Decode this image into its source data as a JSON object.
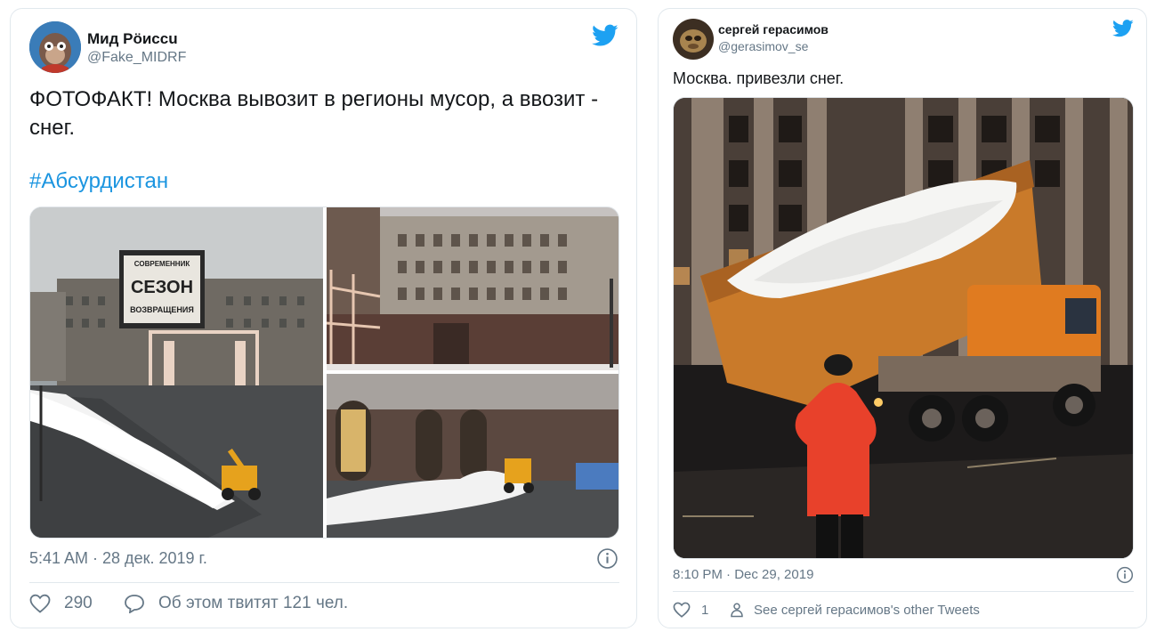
{
  "tweets": [
    {
      "author_name": "Мид Рöиссu",
      "handle": "@Fake_MIDRF",
      "text": "ФОТОФАКТ! Москва вывозит в регионы мусор, а ввозит - снег.",
      "hashtag": "#Абсурдистан",
      "billboard": {
        "line1": "СОВРЕМЕННИК",
        "line2": "СЕЗОН",
        "line3": "ВОЗВРАЩЕНИЯ"
      },
      "timestamp": "5:41 AM · 28 дек. 2019 г.",
      "likes": "290",
      "conversation": "Об этом твитят 121 чел.",
      "icons": [
        "twitter-bird-icon",
        "info-icon",
        "heart-icon",
        "speech-bubble-icon"
      ]
    },
    {
      "author_name": "сергей герасимов",
      "handle": "@gerasimov_se",
      "text": "Москва. привезли снег.",
      "timestamp": "8:10 PM · Dec 29, 2019",
      "likes": "1",
      "other_tweets": "See сергей герасимов's other Tweets",
      "icons": [
        "twitter-bird-icon",
        "info-icon",
        "heart-icon",
        "person-icon"
      ]
    }
  ],
  "colors": {
    "twitter_blue": "#1da1f2",
    "link": "#1b95e0",
    "muted": "#657786",
    "border": "#e1e8ed"
  }
}
